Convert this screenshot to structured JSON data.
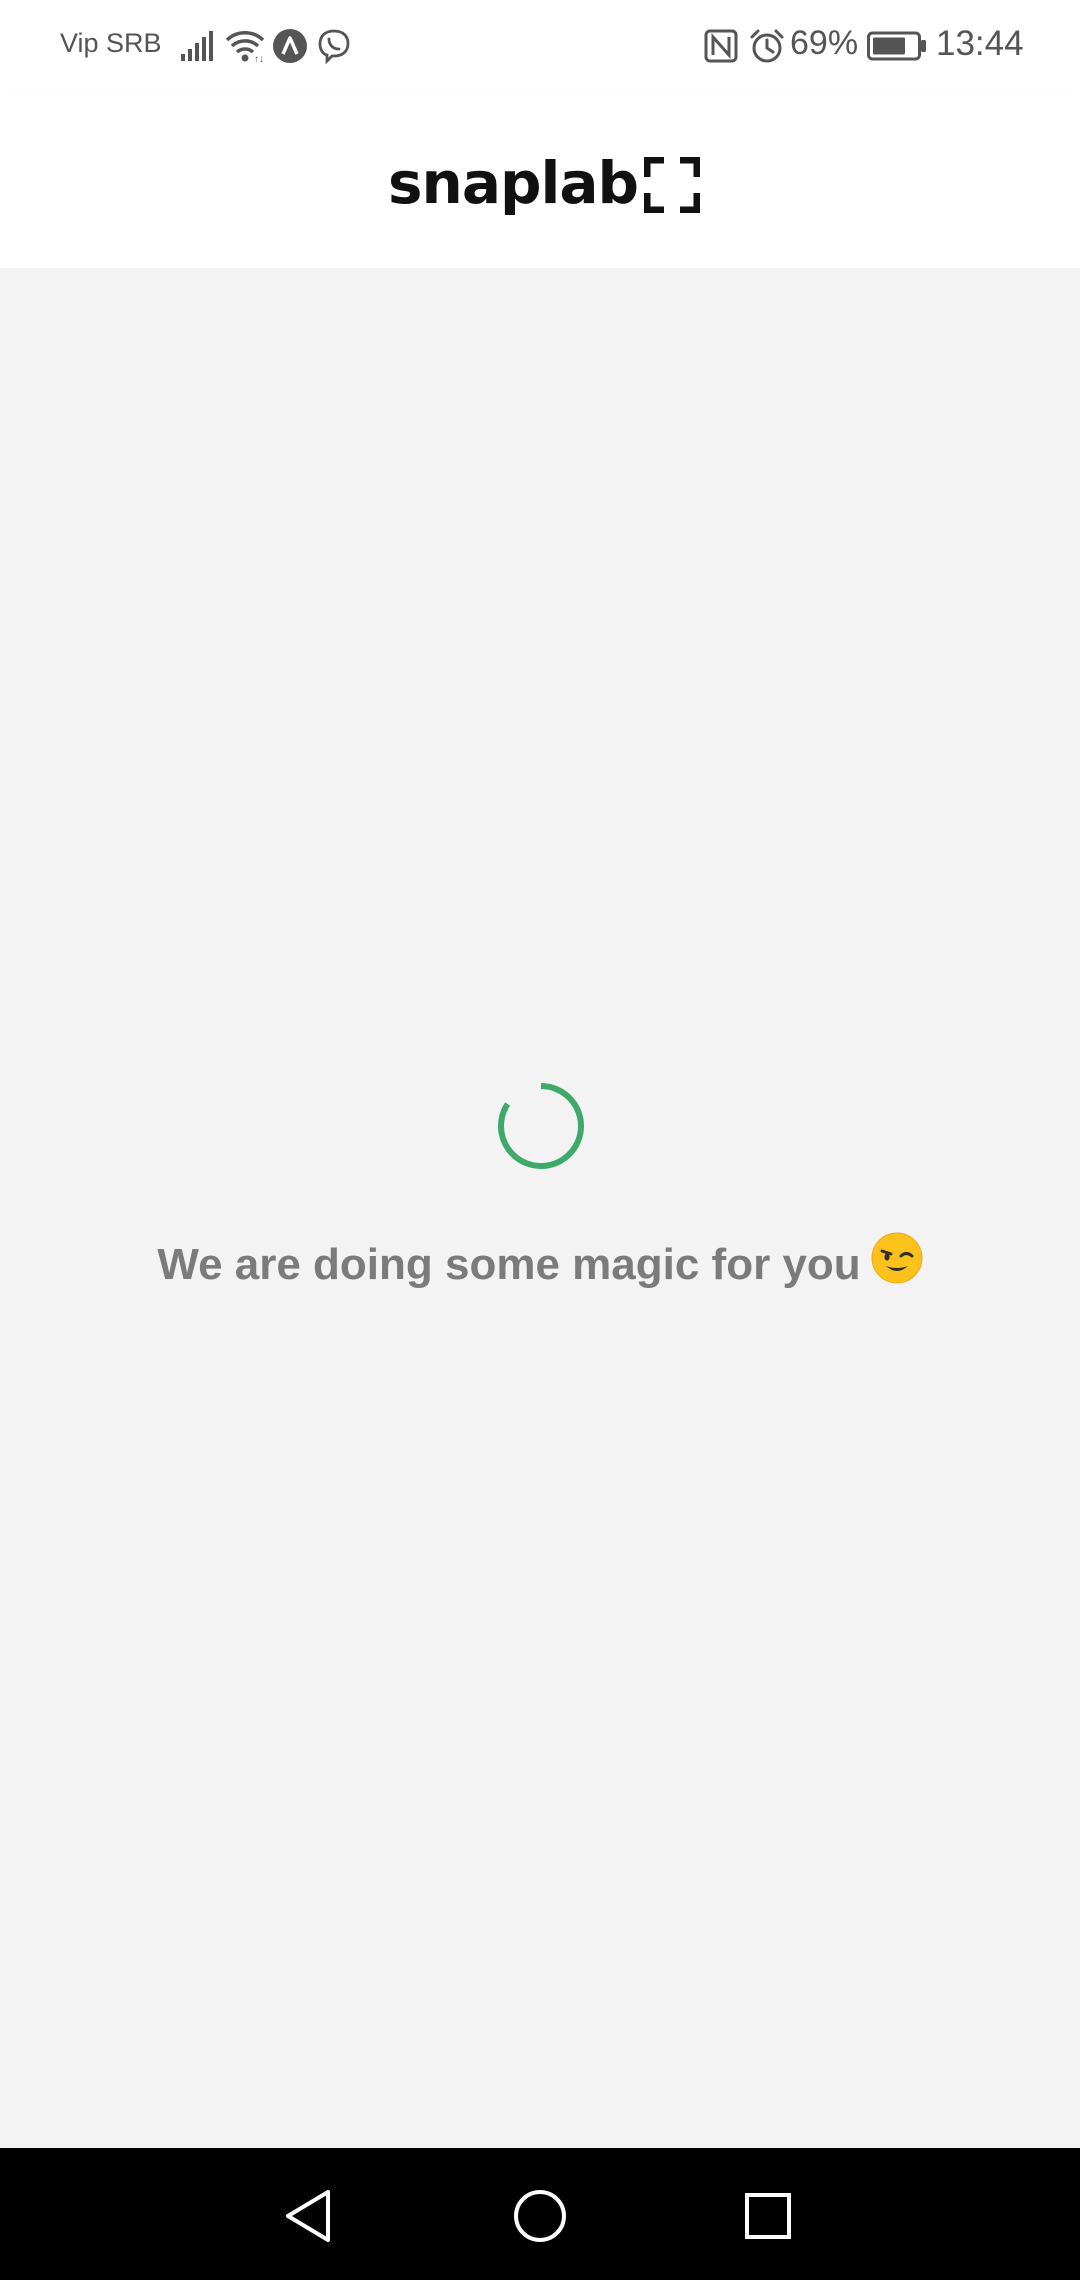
{
  "status_bar": {
    "carrier": "Vip SRB",
    "battery_percent": "69%",
    "time": "13:44",
    "icons": [
      "signal-icon",
      "wifi-icon",
      "app-notification-icon",
      "viber-icon",
      "nfc-icon",
      "alarm-icon",
      "battery-icon"
    ]
  },
  "header": {
    "logo_text": "snaplab"
  },
  "main": {
    "loading_message": "We are doing some magic for you",
    "emoji": "wink-emoji"
  },
  "nav_bar": {
    "buttons": [
      "back-button",
      "home-button",
      "recents-button"
    ]
  },
  "colors": {
    "spinner": "#3daa6a",
    "background": "#f3f3f3",
    "text": "#7b7b7b",
    "header": "#ffffff",
    "nav": "#000000"
  }
}
